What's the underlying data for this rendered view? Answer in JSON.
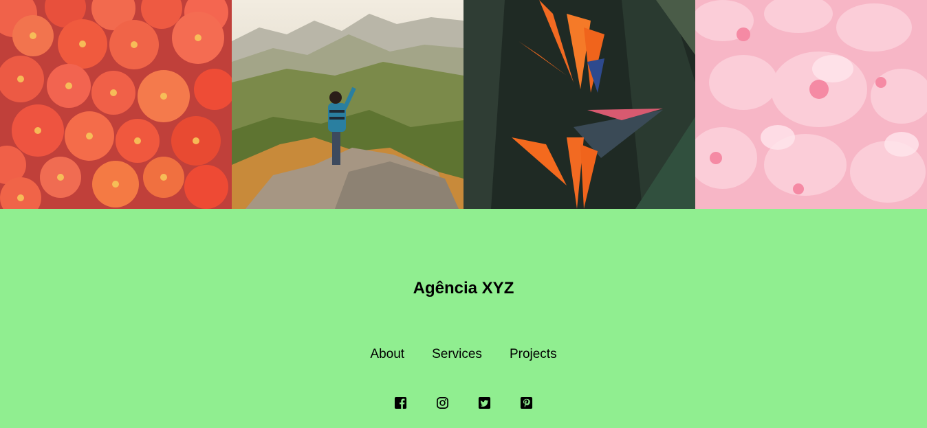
{
  "gallery": {
    "images": [
      {
        "subject": "tomatoes"
      },
      {
        "subject": "hiker-on-mountain"
      },
      {
        "subject": "bird-of-paradise-flower"
      },
      {
        "subject": "pink-blossoms"
      }
    ]
  },
  "footer": {
    "brand": "Agência XYZ",
    "nav": [
      {
        "label": "About"
      },
      {
        "label": "Services"
      },
      {
        "label": "Projects"
      }
    ],
    "social": [
      {
        "icon": "facebook-icon"
      },
      {
        "icon": "instagram-icon"
      },
      {
        "icon": "twitter-icon"
      },
      {
        "icon": "pinterest-icon"
      }
    ]
  },
  "colors": {
    "footer_background": "#90ee90",
    "text": "#000000"
  }
}
